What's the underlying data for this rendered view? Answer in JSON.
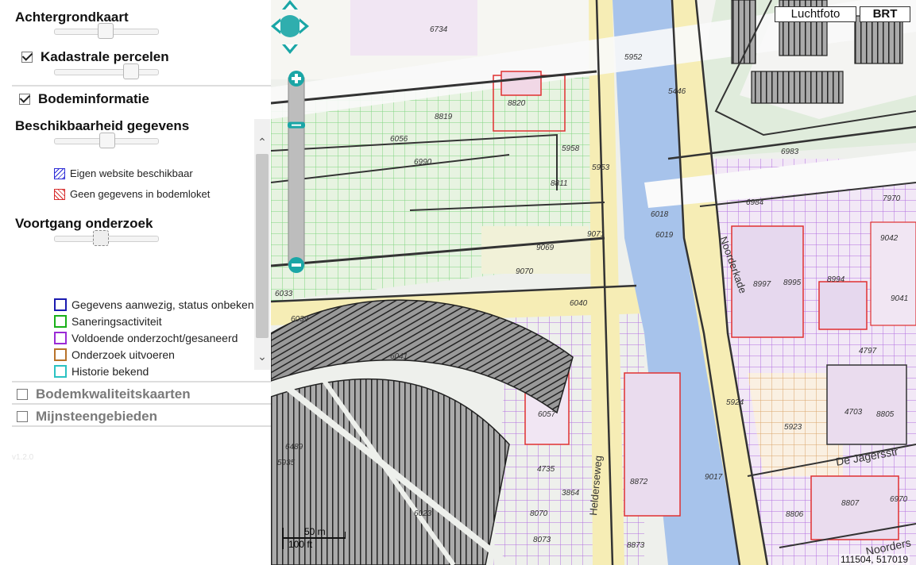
{
  "sidebar": {
    "achtergrondkaart": "Achtergrondkaart",
    "kadastrale": "Kadastrale percelen",
    "bodeminformatie": "Bodeminformatie",
    "beschikbaarheid": "Beschikbaarheid gegevens",
    "legend_availability": [
      {
        "label": "Eigen website beschikbaar",
        "color": "#2b2bd6"
      },
      {
        "label": "Geen gegevens in bodemloket",
        "color": "#d62b2b"
      }
    ],
    "voortgang": "Voortgang onderzoek",
    "legend_progress": [
      {
        "label": "Gegevens aanwezig, status onbekend",
        "color": "#1b1bb0"
      },
      {
        "label": "Saneringsactiviteit",
        "color": "#19b019"
      },
      {
        "label": "Voldoende onderzocht/gesaneerd",
        "color": "#9a2bd6"
      },
      {
        "label": "Onderzoek uitvoeren",
        "color": "#b8732b"
      },
      {
        "label": "Historie bekend",
        "color": "#2bc2c2"
      }
    ],
    "bodemkwaliteit": "Bodemkwaliteitskaarten",
    "mijnsteen": "Mijnsteengebieden",
    "version": "v1.2.0"
  },
  "sliders": {
    "achtergrond_opacity": 0.5,
    "kadastrale_opacity": 0.73,
    "beschikbaarheid_opacity": 0.5,
    "voortgang_opacity": 0.45
  },
  "map": {
    "layer_luchtfoto": "Luchtfoto",
    "layer_brt": "BRT",
    "selected_layer": "BRT",
    "scale_m": "50 m",
    "scale_ft": "100 ft",
    "coords": "111504, 517019",
    "zoom_level_fraction": 0.21,
    "streets": [
      "Noorderkade",
      "Helderseweg",
      "De Jagersstr",
      "Noorders"
    ],
    "parcels": [
      "6734",
      "5952",
      "5446",
      "8820",
      "8819",
      "6056",
      "5958",
      "6990",
      "5953",
      "8811",
      "6983",
      "9042",
      "6984",
      "7970",
      "9069",
      "9071",
      "6018",
      "6019",
      "9070",
      "8997",
      "8995",
      "8994",
      "9041",
      "6040",
      "6039",
      "6041",
      "4797",
      "5924",
      "4703",
      "8805",
      "6057",
      "5923",
      "6033",
      "4735",
      "3864",
      "8872",
      "9017",
      "6970",
      "8807",
      "8806",
      "8070",
      "8073",
      "8873",
      "6023",
      "6489",
      "5935"
    ],
    "colors": {
      "water": "#a7c3eb",
      "road": "#f6edb5",
      "green_grid": "#7fd67f",
      "purple_grid": "#b36ee0",
      "red": "#e03030",
      "dark": "#333333"
    }
  }
}
